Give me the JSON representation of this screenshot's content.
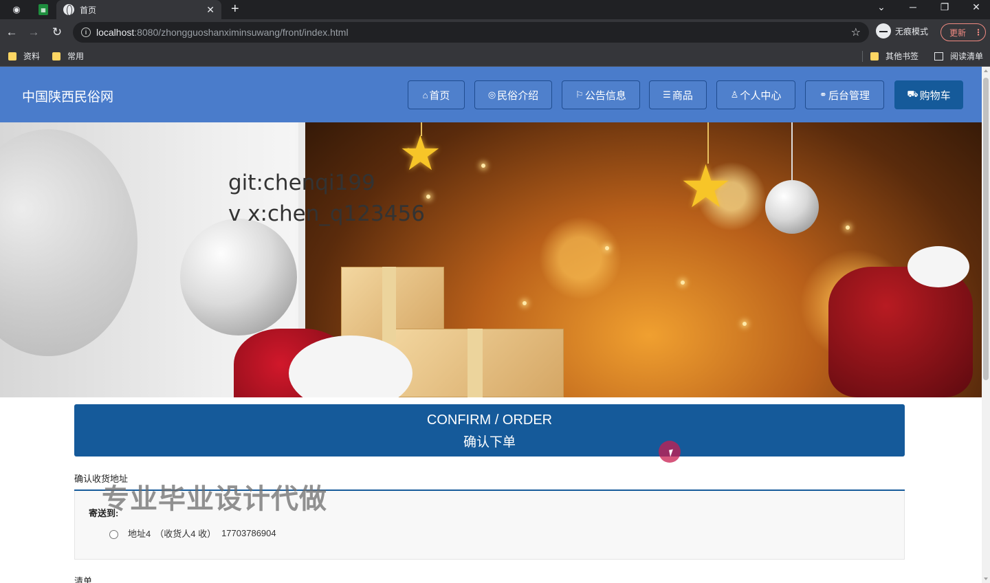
{
  "browser": {
    "tab_title": "首页",
    "tab_close": "✕",
    "new_tab": "+",
    "url_host": "localhost",
    "url_rest": ":8080/zhongguoshanximinsuwang/front/index.html",
    "incognito_label": "无痕模式",
    "update_label": "更新",
    "bookmarks": [
      "资料",
      "常用"
    ],
    "other_bookmarks": "其他书签",
    "reading_list": "阅读清单",
    "icons": {
      "back": "arrow-left-icon",
      "forward": "arrow-right-icon",
      "reload": "reload-icon",
      "star": "star-icon",
      "minimize": "minimize-icon",
      "maximize": "restore-icon",
      "close": "close-icon",
      "tab_search": "chevron-down-icon"
    }
  },
  "site": {
    "title": "中国陕西民俗网",
    "nav": [
      {
        "label": "首页",
        "icon": "home-icon"
      },
      {
        "label": "民俗介绍",
        "icon": "palette-icon"
      },
      {
        "label": "公告信息",
        "icon": "flag-icon"
      },
      {
        "label": "商品",
        "icon": "list-icon"
      },
      {
        "label": "个人中心",
        "icon": "user-icon"
      },
      {
        "label": "后台管理",
        "icon": "link-icon"
      },
      {
        "label": "购物车",
        "icon": "cart-icon"
      }
    ],
    "active_nav_index": 6
  },
  "banner": {
    "overlay_line1": "git:chenqi199",
    "overlay_line2": "v x:chen_q123456"
  },
  "order": {
    "heading_en": "CONFIRM / ORDER",
    "heading_cn": "确认下单",
    "address_section_label": "确认收货地址",
    "watermark": "专业毕业设计代做",
    "ship_to_label": "寄送到:",
    "address": {
      "name": "地址4",
      "receiver": "（收货人4 收）",
      "phone": "17703786904"
    },
    "list_label": "清单"
  },
  "colors": {
    "header_bg": "#4a7ccb",
    "accent": "#155a9a",
    "chrome_dark": "#202124",
    "chrome": "#35363a"
  }
}
